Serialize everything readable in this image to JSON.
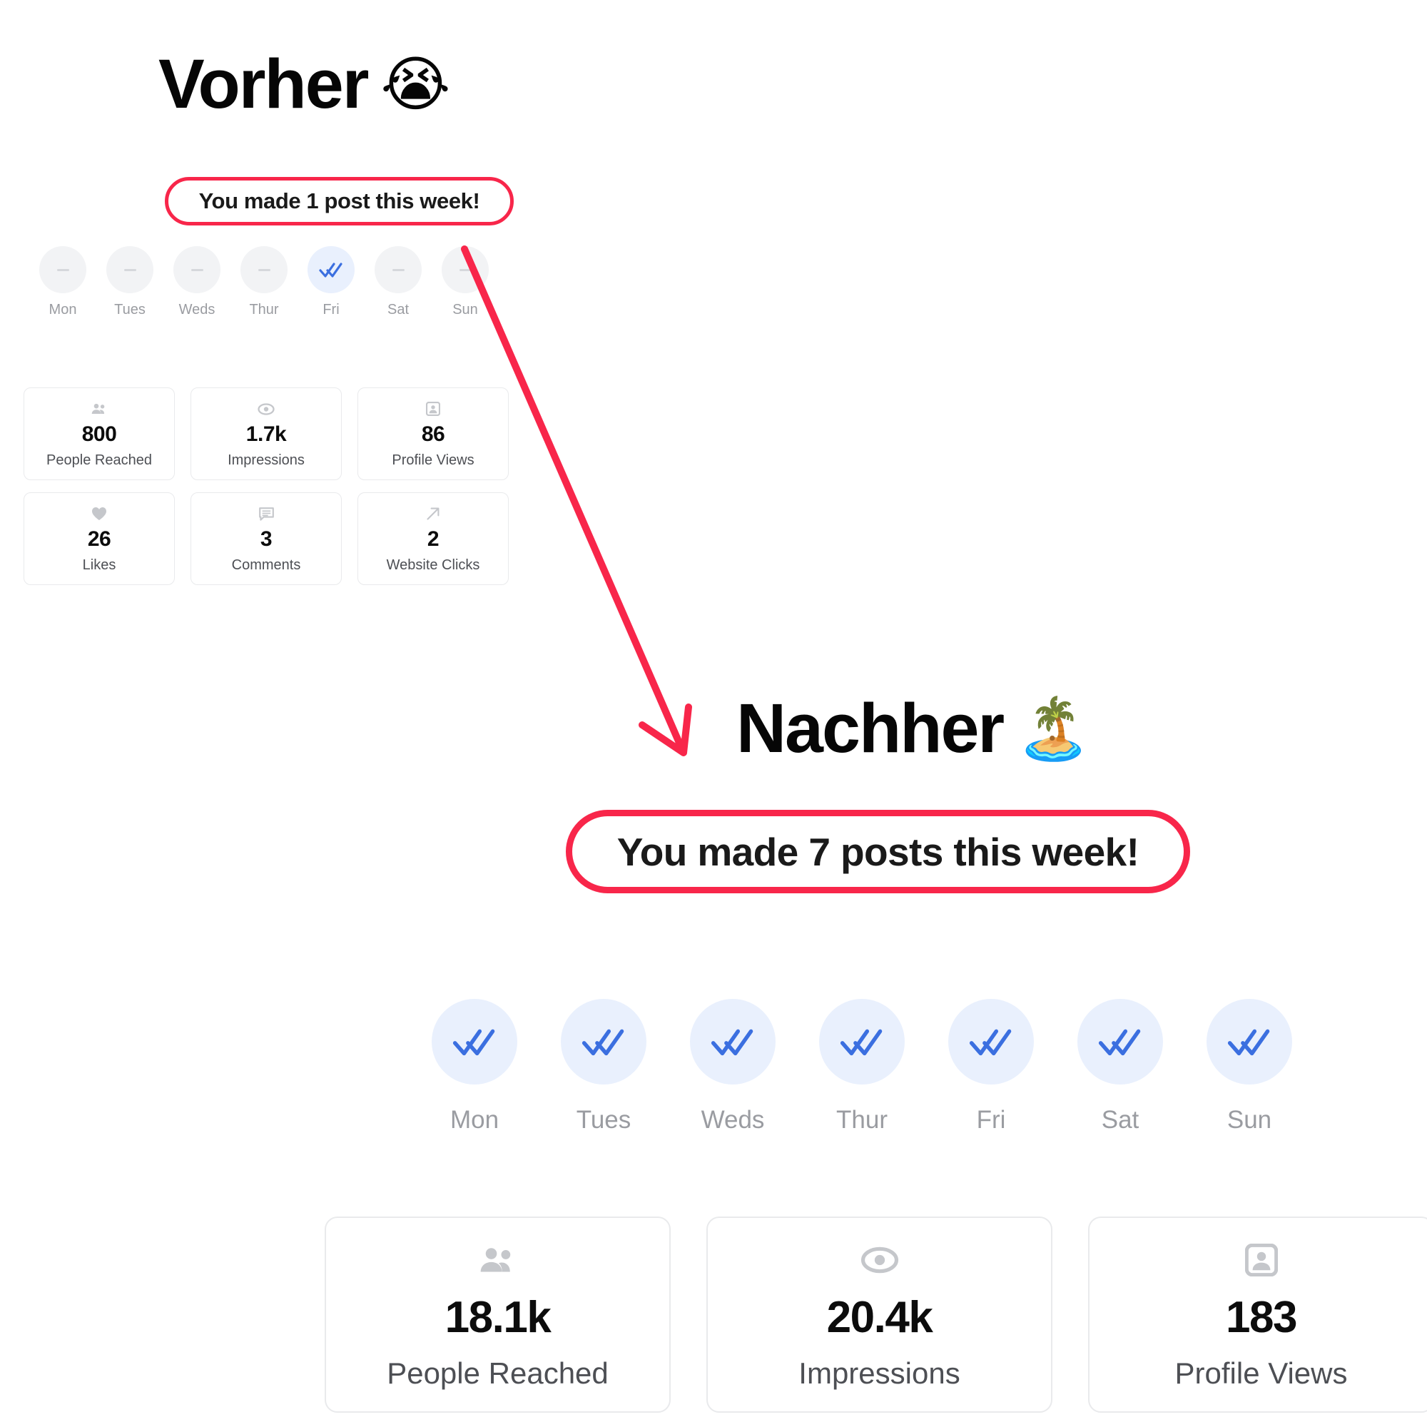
{
  "before": {
    "heading": "Vorher",
    "heading_emoji": "😭",
    "banner": "You made 1 post this week!",
    "accent_color": "#f8264a",
    "week": {
      "days": [
        {
          "label": "Mon",
          "posted": false
        },
        {
          "label": "Tues",
          "posted": false
        },
        {
          "label": "Weds",
          "posted": false
        },
        {
          "label": "Thur",
          "posted": false
        },
        {
          "label": "Fri",
          "posted": true
        },
        {
          "label": "Sat",
          "posted": false
        },
        {
          "label": "Sun",
          "posted": false
        }
      ]
    },
    "stats": [
      {
        "icon": "people-icon",
        "value": "800",
        "label": "People Reached"
      },
      {
        "icon": "eye-icon",
        "value": "1.7k",
        "label": "Impressions"
      },
      {
        "icon": "profile-icon",
        "value": "86",
        "label": "Profile Views"
      },
      {
        "icon": "heart-icon",
        "value": "26",
        "label": "Likes"
      },
      {
        "icon": "comment-icon",
        "value": "3",
        "label": "Comments"
      },
      {
        "icon": "arrow-up-right-icon",
        "value": "2",
        "label": "Website Clicks"
      }
    ]
  },
  "after": {
    "heading": "Nachher",
    "heading_emoji": "🏝️",
    "banner": "You made 7 posts this week!",
    "accent_color": "#f8264a",
    "week": {
      "days": [
        {
          "label": "Mon",
          "posted": true
        },
        {
          "label": "Tues",
          "posted": true
        },
        {
          "label": "Weds",
          "posted": true
        },
        {
          "label": "Thur",
          "posted": true
        },
        {
          "label": "Fri",
          "posted": true
        },
        {
          "label": "Sat",
          "posted": true
        },
        {
          "label": "Sun",
          "posted": true
        }
      ]
    },
    "stats": [
      {
        "icon": "people-icon",
        "value": "18.1k",
        "label": "People Reached"
      },
      {
        "icon": "eye-icon",
        "value": "20.4k",
        "label": "Impressions"
      },
      {
        "icon": "profile-icon",
        "value": "183",
        "label": "Profile Views"
      }
    ]
  },
  "annotation": {
    "arrow_color": "#f8264a",
    "arrow_name": "red-arrow-before-to-after"
  },
  "colors": {
    "check_blue": "#3b6fe0",
    "circle_inactive": "#f2f3f5",
    "circle_active": "#e9f0fd",
    "icon_gray": "#c5c7cb",
    "label_gray": "#9a9ca1"
  }
}
